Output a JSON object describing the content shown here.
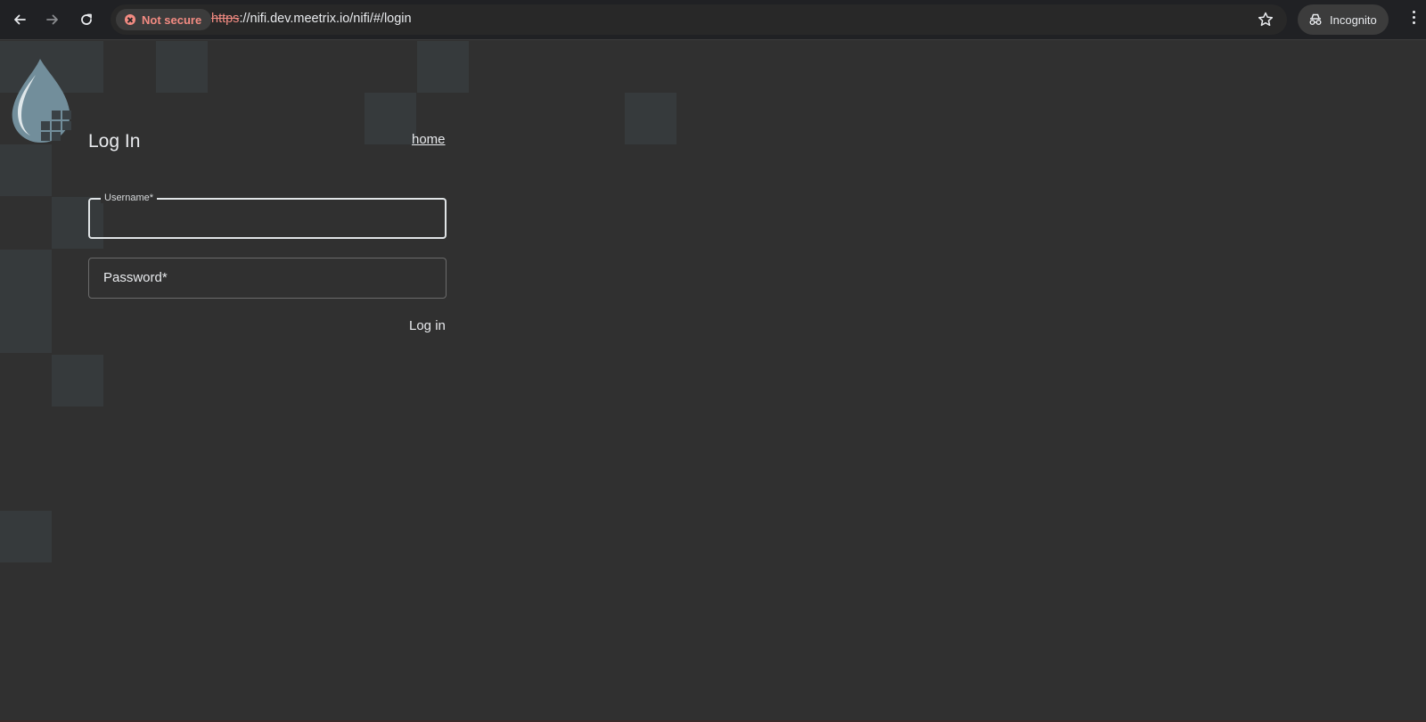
{
  "browser": {
    "security_label": "Not secure",
    "url_scheme": "https",
    "url_rest": "://nifi.dev.meetrix.io/nifi/#/login",
    "incognito_label": "Incognito",
    "colors": {
      "chrome_bg": "#202124",
      "omnibox_bg": "#282828",
      "warning": "#f28b82"
    },
    "icons": [
      "back-arrow-icon",
      "forward-arrow-icon",
      "reload-icon",
      "error-icon",
      "star-icon",
      "incognito-icon",
      "kebab-menu-icon"
    ]
  },
  "login": {
    "title": "Log In",
    "home_link": "home",
    "username": {
      "label": "Username*",
      "value": ""
    },
    "password": {
      "label": "Password*",
      "value": ""
    },
    "submit_label": "Log in"
  },
  "theme": {
    "page_bg": "#303030",
    "tile_color": "#363a3c",
    "logo_color": "#728e9b"
  }
}
